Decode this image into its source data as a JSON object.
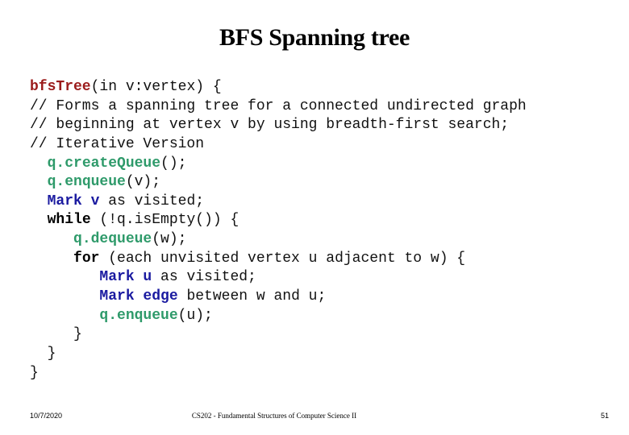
{
  "slide": {
    "title": "BFS Spanning tree"
  },
  "code": {
    "lines": [
      {
        "indent": "",
        "parts": [
          {
            "t": "bfsTree",
            "s": "fn"
          },
          {
            "t": "(in v:vertex) {",
            "s": "plain"
          }
        ]
      },
      {
        "indent": "",
        "parts": [
          {
            "t": "// Forms a spanning tree for a connected undirected graph",
            "s": "plain"
          }
        ]
      },
      {
        "indent": "",
        "parts": [
          {
            "t": "// beginning at vertex v by using breadth-first search;",
            "s": "plain"
          }
        ]
      },
      {
        "indent": "",
        "parts": [
          {
            "t": "// Iterative Version",
            "s": "plain"
          }
        ]
      },
      {
        "indent": "  ",
        "parts": [
          {
            "t": "q.createQueue",
            "s": "op"
          },
          {
            "t": "();",
            "s": "plain"
          }
        ]
      },
      {
        "indent": "  ",
        "parts": [
          {
            "t": "q.enqueue",
            "s": "op"
          },
          {
            "t": "(v);",
            "s": "plain"
          }
        ]
      },
      {
        "indent": "  ",
        "parts": [
          {
            "t": "Mark v",
            "s": "kw"
          },
          {
            "t": " as visited;",
            "s": "plain"
          }
        ]
      },
      {
        "indent": "  ",
        "parts": [
          {
            "t": "while",
            "s": "ctl"
          },
          {
            "t": " (!q.isEmpty()) {",
            "s": "plain"
          }
        ]
      },
      {
        "indent": "     ",
        "parts": [
          {
            "t": "q.dequeue",
            "s": "op"
          },
          {
            "t": "(w);",
            "s": "plain"
          }
        ]
      },
      {
        "indent": "     ",
        "parts": [
          {
            "t": "for",
            "s": "ctl"
          },
          {
            "t": " (each unvisited vertex u adjacent to w) {",
            "s": "plain"
          }
        ]
      },
      {
        "indent": "        ",
        "parts": [
          {
            "t": "Mark u",
            "s": "kw"
          },
          {
            "t": " as visited;",
            "s": "plain"
          }
        ]
      },
      {
        "indent": "        ",
        "parts": [
          {
            "t": "Mark edge",
            "s": "kw"
          },
          {
            "t": " between w and u;",
            "s": "plain"
          }
        ]
      },
      {
        "indent": "        ",
        "parts": [
          {
            "t": "q.enqueue",
            "s": "op"
          },
          {
            "t": "(u);",
            "s": "plain"
          }
        ]
      },
      {
        "indent": "     ",
        "parts": [
          {
            "t": "}",
            "s": "plain"
          }
        ]
      },
      {
        "indent": "  ",
        "parts": [
          {
            "t": "}",
            "s": "plain"
          }
        ]
      },
      {
        "indent": "",
        "parts": [
          {
            "t": "}",
            "s": "plain"
          }
        ]
      }
    ]
  },
  "footer": {
    "date": "10/7/2020",
    "course": "CS202 - Fundamental Structures of Computer Science II",
    "page": "51"
  },
  "colors": {
    "function_name": "#9b1b1b",
    "keyword": "#1a1aa0",
    "operation": "#2e9a6a",
    "text": "#111111"
  }
}
